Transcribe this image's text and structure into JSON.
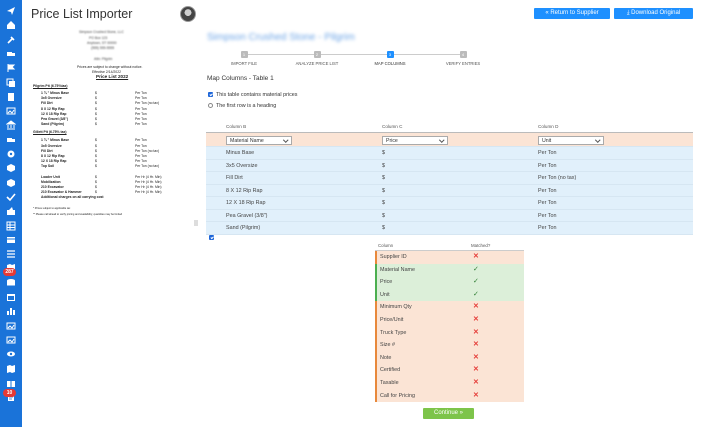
{
  "page_title": "Price List Importer",
  "header": {
    "return_label": "« Return to Supplier",
    "download_label": "⤓ Download Original"
  },
  "supplier_name": "Simpson Crushed Stone - Pilgrim",
  "pdf": {
    "company": "Simpson Crushed Stone, LLC",
    "addr1": "PO Box 123",
    "addr2": "Anytown, ST 00000",
    "addr3": "(555) 555-5555",
    "attention": "Attn: Pilgrim",
    "notice": "Prices are subject to change without notice.",
    "effective": "Effective 2/14/2022",
    "list_title": "Price List 2022",
    "pilgrim_section": "Pilgrim Pit (6.75%tax)",
    "pilgrim_rows": [
      [
        "1 ¾ \" Minus Base",
        "$",
        "Per Ton"
      ],
      [
        "3x5 Oversize",
        "$",
        "Per Ton"
      ],
      [
        "Fill Dirt",
        "$",
        "Per Ton (no tax)"
      ],
      [
        "8 X 12 Rip Rap",
        "$",
        "Per Ton"
      ],
      [
        "12 X 18 Rip Rap",
        "$",
        "Per Ton"
      ],
      [
        "Pea Gravel  (3/8\")",
        "$",
        "Per Ton"
      ],
      [
        "Sand (Pilgrim)",
        "$",
        "Per Ton"
      ]
    ],
    "gillett_section": "Gillett Pit (6.75% tax)",
    "gillett_rows": [
      [
        "1 ¾ \" Minus Base",
        "$",
        "Per Ton"
      ],
      [
        "3x5 Oversize",
        "$",
        "Per Ton"
      ],
      [
        "Fill Dirt",
        "$",
        "Per Ton (no tax)"
      ],
      [
        "8 X 12 Rip Rap",
        "$",
        "Per Ton"
      ],
      [
        "12 X 18 Rip Rap",
        "$",
        "Per Ton"
      ],
      [
        "Top Soil",
        "$",
        "Per Ton (no tax)"
      ]
    ],
    "equip_rows": [
      [
        "Loader Unit",
        "$",
        "Per Hr (4 Hr. Min)"
      ],
      [
        "Mobilization",
        "$",
        "Per Hr (4 Hr. Min)"
      ],
      [
        "210 Excavator",
        "$",
        "Per Hr (4 Hr. Min)"
      ],
      [
        "210 Excavator & Hammer",
        "$",
        "Per Hr (4 Hr. Min)"
      ],
      [
        "Additional charges on all carrying cost",
        "",
        ""
      ]
    ],
    "foot1": "* Prices subject to applicable tax",
    "foot2": "** Please call ahead to verify pricing and availability; quantities may be limited"
  },
  "stepper": {
    "steps": [
      {
        "label": "IMPORT FILE",
        "num": "1",
        "state": "done"
      },
      {
        "label": "ANALYZE PRICE LIST",
        "num": "2",
        "state": "done"
      },
      {
        "label": "MAP COLUMNS",
        "num": "3",
        "state": "active"
      },
      {
        "label": "VERIFY ENTRIES",
        "num": "4",
        "state": "todo"
      }
    ]
  },
  "map_title": "Map Columns - Table 1",
  "options": {
    "material_prices": "This table contains material prices",
    "first_row_heading": "The first row is a heading"
  },
  "table": {
    "col_headers": [
      "Column B",
      "Column C",
      "Column D"
    ],
    "selects": [
      "Material Name",
      "Price",
      "Unit"
    ],
    "rows": [
      [
        "Minus Base",
        "$",
        "Per Ton"
      ],
      [
        "3x5 Oversize",
        "$",
        "Per Ton"
      ],
      [
        "Fill Dirt",
        "$",
        "Per Ton (no tax)"
      ],
      [
        "8 X 12 Rip Rap",
        "$",
        "Per Ton"
      ],
      [
        "12 X 18 Rip Rap",
        "$",
        "Per Ton"
      ],
      [
        "Pea Gravel (3/8\")",
        "$",
        "Per Ton"
      ],
      [
        "Sand (Pilgrim)",
        "$",
        "Per Ton"
      ]
    ]
  },
  "match": {
    "col_label": "Column",
    "matched_label": "Matched?",
    "rows": [
      {
        "name": "Supplier ID",
        "matched": false
      },
      {
        "name": "Material Name",
        "matched": true
      },
      {
        "name": "Price",
        "matched": true
      },
      {
        "name": "Unit",
        "matched": true
      },
      {
        "name": "Minimum Qty",
        "matched": false
      },
      {
        "name": "Price/Unit",
        "matched": false
      },
      {
        "name": "Truck Type",
        "matched": false
      },
      {
        "name": "Size #",
        "matched": false
      },
      {
        "name": "Note",
        "matched": false
      },
      {
        "name": "Certified",
        "matched": false
      },
      {
        "name": "Taxable",
        "matched": false
      },
      {
        "name": "Call for Pricing",
        "matched": false
      }
    ],
    "yes_mark": "✓",
    "no_mark": "✕"
  },
  "continue_label": "Continue »",
  "sidebar": {
    "badges": [
      "287",
      "10"
    ]
  },
  "colors": {
    "sidebar": "#1a73d9",
    "primary_button": "#1e90ff",
    "continue_button": "#7dc44a",
    "header_row": "#fbe4d5",
    "data_row": "#e1f0fb",
    "matched_row": "#dcefd9"
  }
}
